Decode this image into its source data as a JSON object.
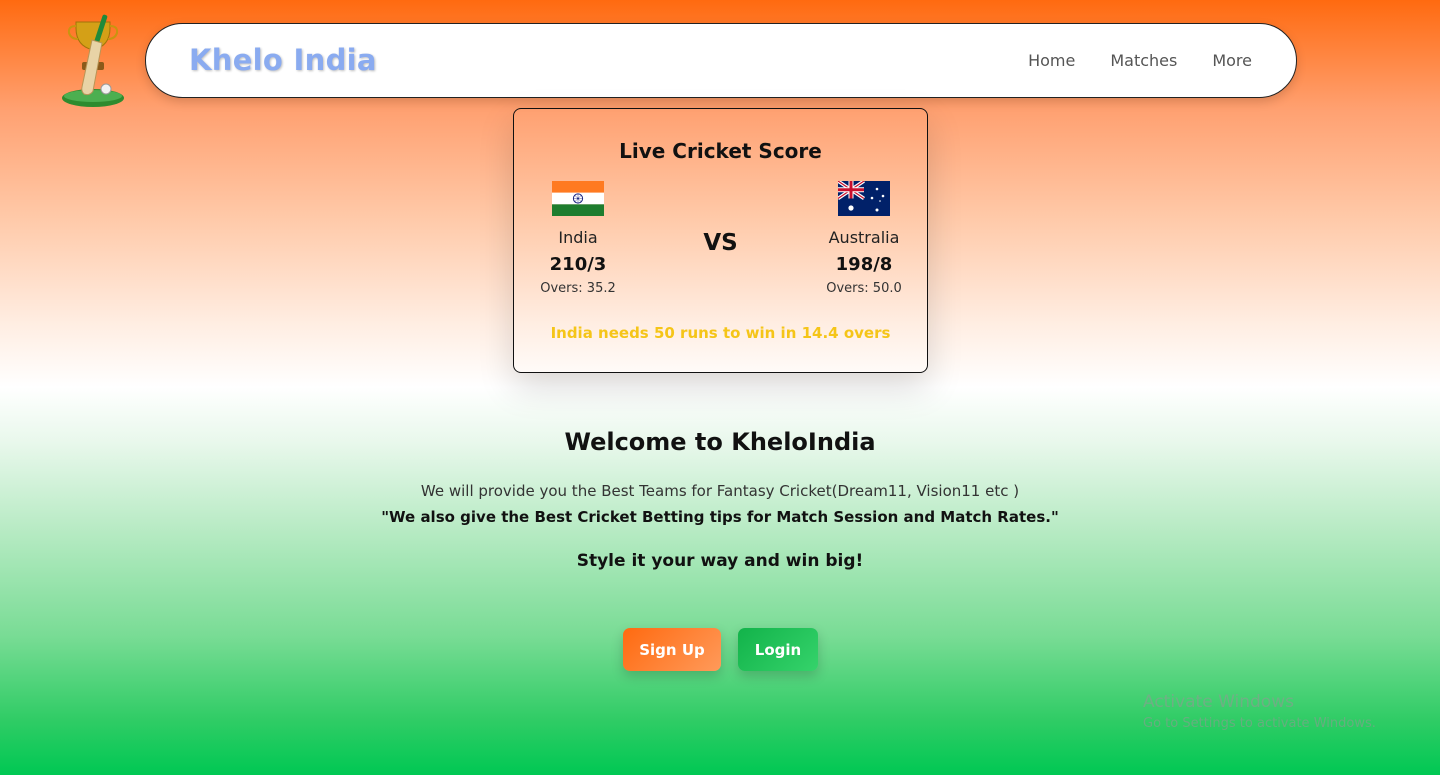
{
  "header": {
    "brand": "Khelo India",
    "nav": [
      "Home",
      "Matches",
      "More"
    ]
  },
  "score_card": {
    "title": "Live Cricket Score",
    "vs": "VS",
    "team1": {
      "name": "India",
      "score": "210/3",
      "overs": "Overs: 35.2",
      "flag": "india-flag"
    },
    "team2": {
      "name": "Australia",
      "score": "198/8",
      "overs": "Overs: 50.0",
      "flag": "australia-flag"
    },
    "status": "India needs 50 runs to win in 14.4 overs"
  },
  "welcome": {
    "title": "Welcome to KheloIndia",
    "tagline": "We will provide you the Best Teams for Fantasy Cricket(Dream11, Vision11 etc )",
    "quote": "\"We also give the Best Cricket Betting tips for Match Session and Match Rates.\"",
    "style_line": "Style it your way and win big!"
  },
  "buttons": {
    "signup": "Sign Up",
    "login": "Login"
  },
  "watermark": {
    "title": "Activate Windows",
    "subtitle": "Go to Settings to activate Windows."
  },
  "colors": {
    "saffron": "#ff6a10",
    "green": "#00c853",
    "brand": "#8aabf0",
    "status": "#f5c518"
  },
  "icons": [
    "trophy-bat-logo-icon",
    "india-flag",
    "australia-flag"
  ]
}
